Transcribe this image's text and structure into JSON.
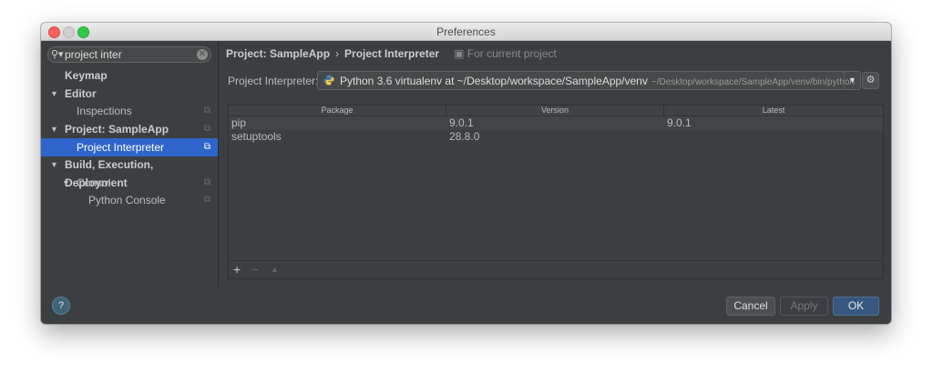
{
  "window": {
    "title": "Preferences"
  },
  "sidebar": {
    "search_value": "project inter",
    "items": [
      {
        "label": "Keymap"
      },
      {
        "label": "Editor"
      },
      {
        "label": "Inspections"
      },
      {
        "label": "Project: SampleApp"
      },
      {
        "label": "Project Interpreter"
      },
      {
        "label": "Build, Execution, Deployment"
      },
      {
        "label": "Console"
      },
      {
        "label": "Python Console"
      }
    ]
  },
  "breadcrumb": {
    "root": "Project: SampleApp",
    "current": "Project Interpreter",
    "scope_note": "For current project"
  },
  "interpreter": {
    "label": "Project Interpreter:",
    "selected": "Python 3.6 virtualenv at ~/Desktop/workspace/SampleApp/venv",
    "path": "~/Desktop/workspace/SampleApp/venv/bin/python"
  },
  "packages": {
    "columns": [
      "Package",
      "Version",
      "Latest"
    ],
    "rows": [
      {
        "package": "pip",
        "version": "9.0.1",
        "latest": "9.0.1"
      },
      {
        "package": "setuptools",
        "version": "28.8.0",
        "latest": ""
      }
    ]
  },
  "toolbar": {
    "add": "+",
    "remove": "−",
    "upgrade": "▲"
  },
  "footer": {
    "help": "?",
    "cancel": "Cancel",
    "apply": "Apply",
    "ok": "OK"
  },
  "colors": {
    "selection": "#2f65ca",
    "ok_button": "#365880",
    "panel": "#3c3f41"
  }
}
